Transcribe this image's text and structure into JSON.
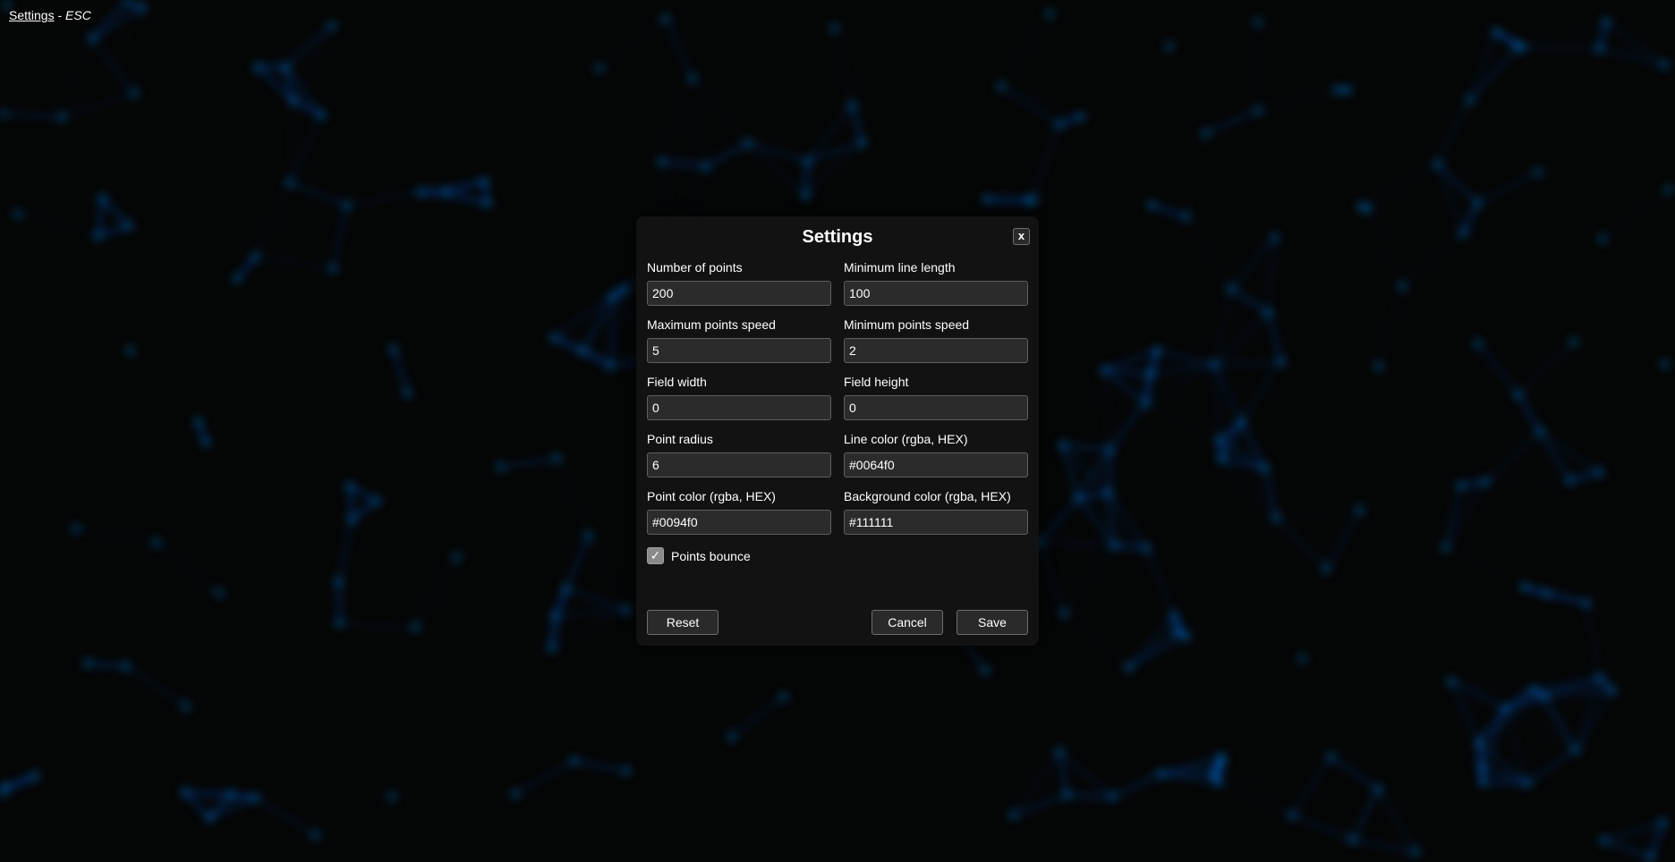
{
  "topbar": {
    "settings_link": "Settings",
    "separator": " - ",
    "shortcut": "ESC"
  },
  "modal": {
    "title": "Settings",
    "close_label": "x",
    "fields": [
      {
        "label": "Number of points",
        "value": "200"
      },
      {
        "label": "Minimum line length",
        "value": "100"
      },
      {
        "label": "Maximum points speed",
        "value": "5"
      },
      {
        "label": "Minimum points speed",
        "value": "2"
      },
      {
        "label": "Field width",
        "value": "0"
      },
      {
        "label": "Field height",
        "value": "0"
      },
      {
        "label": "Point radius",
        "value": "6"
      },
      {
        "label": "Line color (rgba, HEX)",
        "value": "#0064f0"
      },
      {
        "label": "Point color (rgba, HEX)",
        "value": "#0094f0"
      },
      {
        "label": "Background color (rgba, HEX)",
        "value": "#111111"
      }
    ],
    "checkbox": {
      "label": "Points bounce",
      "checked": true,
      "check_glyph": "✓"
    },
    "buttons": {
      "reset": "Reset",
      "cancel": "Cancel",
      "save": "Save"
    }
  },
  "colors": {
    "point": "#0094f0",
    "line": "#0064f0",
    "background": "#111111"
  }
}
